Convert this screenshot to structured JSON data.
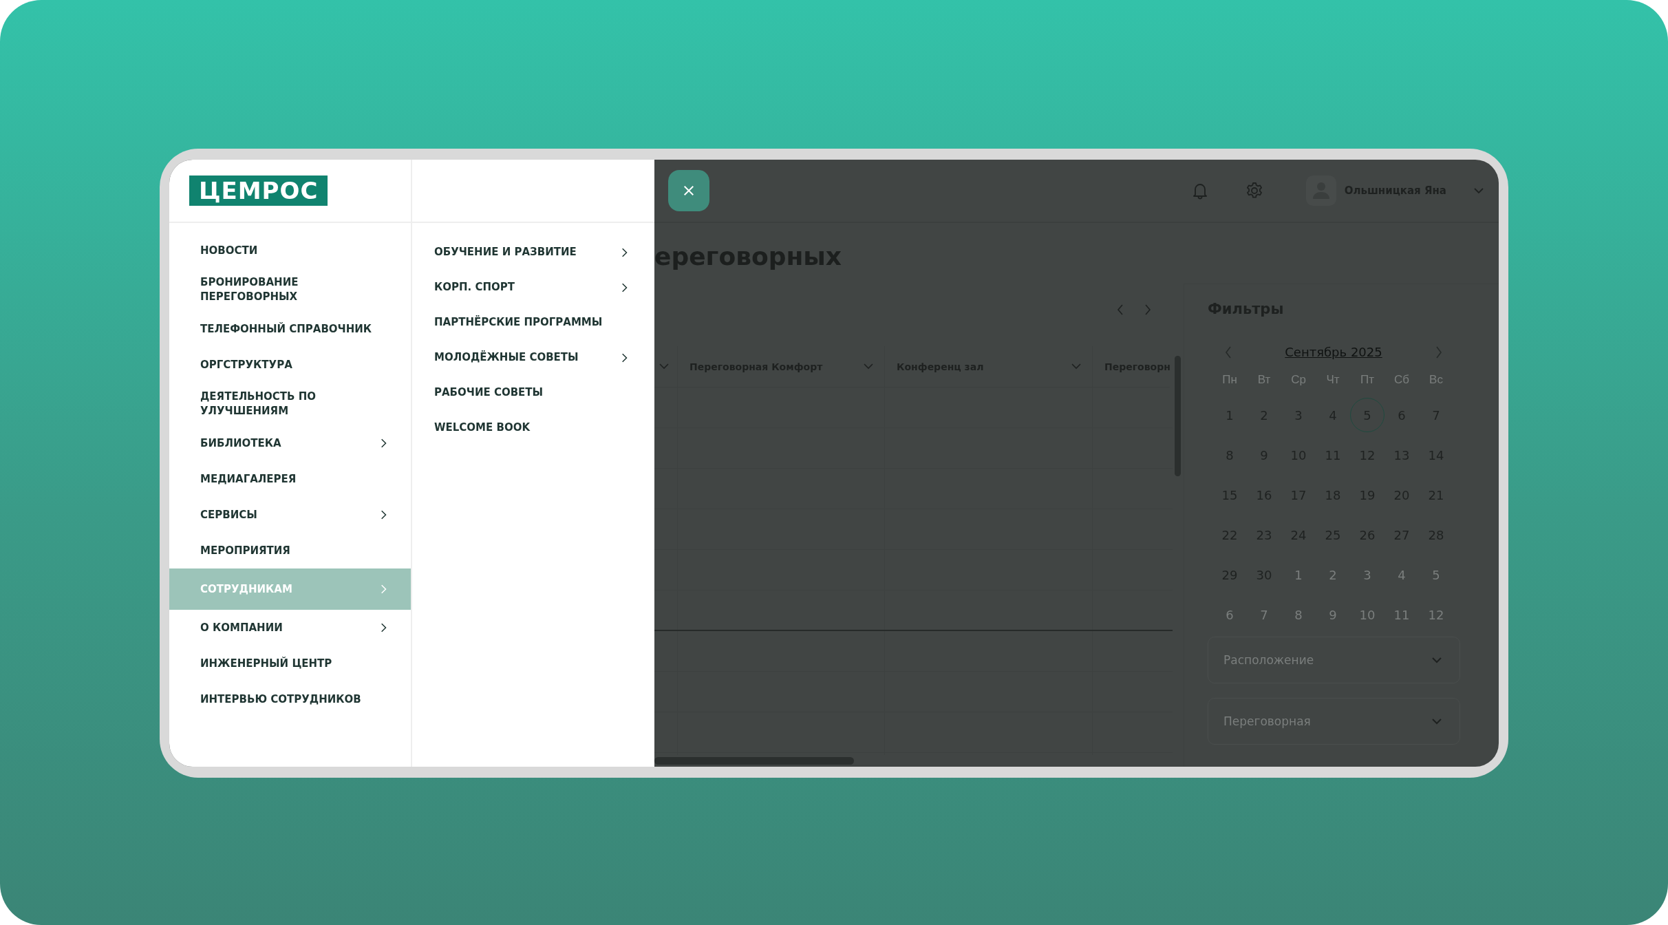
{
  "logo": {
    "text": "ЦЕМРОС"
  },
  "menu": {
    "items": [
      {
        "label": "НОВОСТИ",
        "selected": false,
        "has_children": false
      },
      {
        "label": "БРОНИРОВАНИЕ ПЕРЕГОВОРНЫХ",
        "selected": false,
        "has_children": false
      },
      {
        "label": "ТЕЛЕФОННЫЙ СПРАВОЧНИК",
        "selected": false,
        "has_children": false
      },
      {
        "label": "ОРГСТРУКТУРА",
        "selected": false,
        "has_children": false
      },
      {
        "label": "ДЕЯТЕЛЬНОСТЬ ПО УЛУЧШЕНИЯМ",
        "selected": false,
        "has_children": false
      },
      {
        "label": "БИБЛИОТЕКА",
        "selected": false,
        "has_children": true
      },
      {
        "label": "МЕДИАГАЛЕРЕЯ",
        "selected": false,
        "has_children": false
      },
      {
        "label": "СЕРВИСЫ",
        "selected": false,
        "has_children": true
      },
      {
        "label": "МЕРОПРИЯТИЯ",
        "selected": false,
        "has_children": false
      },
      {
        "label": "СОТРУДНИКАМ",
        "selected": true,
        "has_children": true
      },
      {
        "label": "О КОМПАНИИ",
        "selected": false,
        "has_children": true
      },
      {
        "label": "ИНЖЕНЕРНЫЙ ЦЕНТР",
        "selected": false,
        "has_children": false
      },
      {
        "label": "ИНТЕРВЬЮ СОТРУДНИКОВ",
        "selected": false,
        "has_children": false
      }
    ]
  },
  "submenu": {
    "items": [
      {
        "label": "ОБУЧЕНИЕ И РАЗВИТИЕ",
        "has_children": true
      },
      {
        "label": "КОРП. СПОРТ",
        "has_children": true
      },
      {
        "label": "ПАРТНЁРСКИЕ ПРОГРАММЫ",
        "has_children": false
      },
      {
        "label": "МОЛОДЁЖНЫЕ СОВЕТЫ",
        "has_children": true
      },
      {
        "label": "РАБОЧИЕ СОВЕТЫ",
        "has_children": false
      },
      {
        "label": "WELCOME BOOK",
        "has_children": false
      }
    ]
  },
  "header": {
    "user_name": "Ольшницкая Яна"
  },
  "page": {
    "title": "ереговорных"
  },
  "table": {
    "columns": [
      {
        "label": "Переговорная Комфорт"
      },
      {
        "label": "Конференц зал"
      },
      {
        "label": "Переговорн"
      }
    ]
  },
  "filters": {
    "title": "Фильтры",
    "calendar": {
      "month": "Сентябрь 2025",
      "weekdays": [
        "Пн",
        "Вт",
        "Ср",
        "Чт",
        "Пт",
        "Сб",
        "Вс"
      ],
      "days": [
        {
          "label": "1",
          "in_month": true,
          "selected": false
        },
        {
          "label": "2",
          "in_month": true,
          "selected": false
        },
        {
          "label": "3",
          "in_month": true,
          "selected": false
        },
        {
          "label": "4",
          "in_month": true,
          "selected": false
        },
        {
          "label": "5",
          "in_month": true,
          "selected": true
        },
        {
          "label": "6",
          "in_month": true,
          "selected": false
        },
        {
          "label": "7",
          "in_month": true,
          "selected": false
        },
        {
          "label": "8",
          "in_month": true,
          "selected": false
        },
        {
          "label": "9",
          "in_month": true,
          "selected": false
        },
        {
          "label": "10",
          "in_month": true,
          "selected": false
        },
        {
          "label": "11",
          "in_month": true,
          "selected": false
        },
        {
          "label": "12",
          "in_month": true,
          "selected": false
        },
        {
          "label": "13",
          "in_month": true,
          "selected": false
        },
        {
          "label": "14",
          "in_month": true,
          "selected": false
        },
        {
          "label": "15",
          "in_month": true,
          "selected": false
        },
        {
          "label": "16",
          "in_month": true,
          "selected": false
        },
        {
          "label": "17",
          "in_month": true,
          "selected": false
        },
        {
          "label": "18",
          "in_month": true,
          "selected": false
        },
        {
          "label": "19",
          "in_month": true,
          "selected": false
        },
        {
          "label": "20",
          "in_month": true,
          "selected": false
        },
        {
          "label": "21",
          "in_month": true,
          "selected": false
        },
        {
          "label": "22",
          "in_month": true,
          "selected": false
        },
        {
          "label": "23",
          "in_month": true,
          "selected": false
        },
        {
          "label": "24",
          "in_month": true,
          "selected": false
        },
        {
          "label": "25",
          "in_month": true,
          "selected": false
        },
        {
          "label": "26",
          "in_month": true,
          "selected": false
        },
        {
          "label": "27",
          "in_month": true,
          "selected": false
        },
        {
          "label": "28",
          "in_month": true,
          "selected": false
        },
        {
          "label": "29",
          "in_month": true,
          "selected": false
        },
        {
          "label": "30",
          "in_month": true,
          "selected": false
        },
        {
          "label": "1",
          "in_month": false,
          "selected": false
        },
        {
          "label": "2",
          "in_month": false,
          "selected": false
        },
        {
          "label": "3",
          "in_month": false,
          "selected": false
        },
        {
          "label": "4",
          "in_month": false,
          "selected": false
        },
        {
          "label": "5",
          "in_month": false,
          "selected": false
        },
        {
          "label": "6",
          "in_month": false,
          "selected": false
        },
        {
          "label": "7",
          "in_month": false,
          "selected": false
        },
        {
          "label": "8",
          "in_month": false,
          "selected": false
        },
        {
          "label": "9",
          "in_month": false,
          "selected": false
        },
        {
          "label": "10",
          "in_month": false,
          "selected": false
        },
        {
          "label": "11",
          "in_month": false,
          "selected": false
        },
        {
          "label": "12",
          "in_month": false,
          "selected": false
        }
      ]
    },
    "dropdowns": [
      {
        "placeholder": "Расположение"
      },
      {
        "placeholder": "Переговорная"
      }
    ]
  }
}
